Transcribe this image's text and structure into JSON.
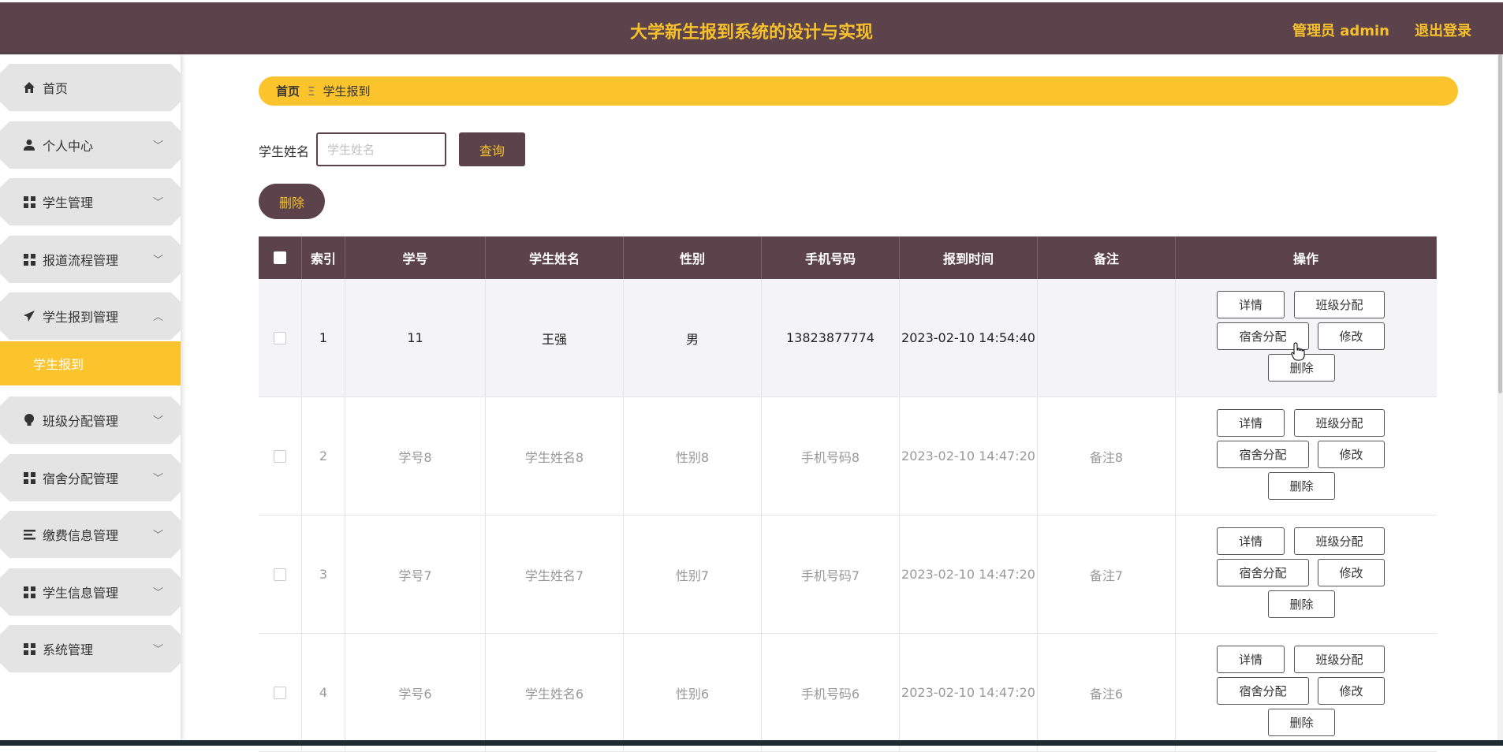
{
  "header": {
    "title": "大学新生报到系统的设计与实现",
    "user_label": "管理员 admin",
    "logout_label": "退出登录"
  },
  "sidebar": {
    "items": [
      {
        "label": "首页",
        "icon": "home-icon"
      },
      {
        "label": "个人中心",
        "icon": "user-icon"
      },
      {
        "label": "学生管理",
        "icon": "grid-icon"
      },
      {
        "label": "报道流程管理",
        "icon": "grid-icon"
      },
      {
        "label": "学生报到管理",
        "icon": "paper-plane-icon"
      },
      {
        "label": "班级分配管理",
        "icon": "bulb-icon"
      },
      {
        "label": "宿舍分配管理",
        "icon": "grid-icon"
      },
      {
        "label": "缴费信息管理",
        "icon": "list-icon"
      },
      {
        "label": "学生信息管理",
        "icon": "grid-icon"
      },
      {
        "label": "系统管理",
        "icon": "grid-icon"
      }
    ],
    "active_sub_item": "学生报到"
  },
  "breadcrumb": {
    "home": "首页",
    "separator": "Ξ",
    "current": "学生报到"
  },
  "search": {
    "label": "学生姓名",
    "placeholder": "学生姓名",
    "value": "",
    "query_label": "查询"
  },
  "batch_delete_label": "删除",
  "table": {
    "headers": [
      "索引",
      "学号",
      "学生姓名",
      "性别",
      "手机号码",
      "报到时间",
      "备注",
      "操作"
    ],
    "rows": [
      {
        "index": "1",
        "student_no": "11",
        "name": "王强",
        "gender": "男",
        "phone": "13823877774",
        "time": "2023-02-10 14:54:40",
        "note": ""
      },
      {
        "index": "2",
        "student_no": "学号8",
        "name": "学生姓名8",
        "gender": "性别8",
        "phone": "手机号码8",
        "time": "2023-02-10 14:47:20",
        "note": "备注8"
      },
      {
        "index": "3",
        "student_no": "学号7",
        "name": "学生姓名7",
        "gender": "性别7",
        "phone": "手机号码7",
        "time": "2023-02-10 14:47:20",
        "note": "备注7"
      },
      {
        "index": "4",
        "student_no": "学号6",
        "name": "学生姓名6",
        "gender": "性别6",
        "phone": "手机号码6",
        "time": "2023-02-10 14:47:20",
        "note": "备注6"
      }
    ],
    "actions": {
      "detail": "详情",
      "class_assign": "班级分配",
      "dorm_assign": "宿舍分配",
      "edit": "修改",
      "delete": "删除"
    }
  },
  "colors": {
    "primary": "#5b424b",
    "accent": "#fcc42c"
  }
}
